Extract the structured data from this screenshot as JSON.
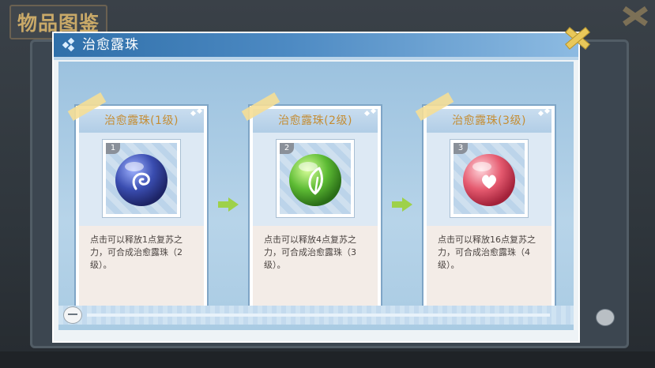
{
  "background": {
    "title": "物品图鉴"
  },
  "dialog": {
    "title": "治愈露珠"
  },
  "cards": [
    {
      "name": "治愈露珠(1级)",
      "slot": "1",
      "orb_icon": "spiral-icon",
      "orb_color": "#3a4db0",
      "desc": "点击可以释放1点复苏之力，可合成治愈露珠（2级）。"
    },
    {
      "name": "治愈露珠(2级)",
      "slot": "2",
      "orb_icon": "leaf-icon",
      "orb_color": "#5dbb34",
      "desc": "点击可以释放4点复苏之力，可合成治愈露珠（3级）。"
    },
    {
      "name": "治愈露珠(3级)",
      "slot": "3",
      "orb_icon": "heart-icon",
      "orb_color": "#e55a6f",
      "desc": "点击可以释放16点复苏之力，可合成治愈露珠（4级）。"
    }
  ],
  "colors": {
    "header": "#2f6fa9",
    "card_title": "#c48d34",
    "arrow": "#9ed14a"
  }
}
